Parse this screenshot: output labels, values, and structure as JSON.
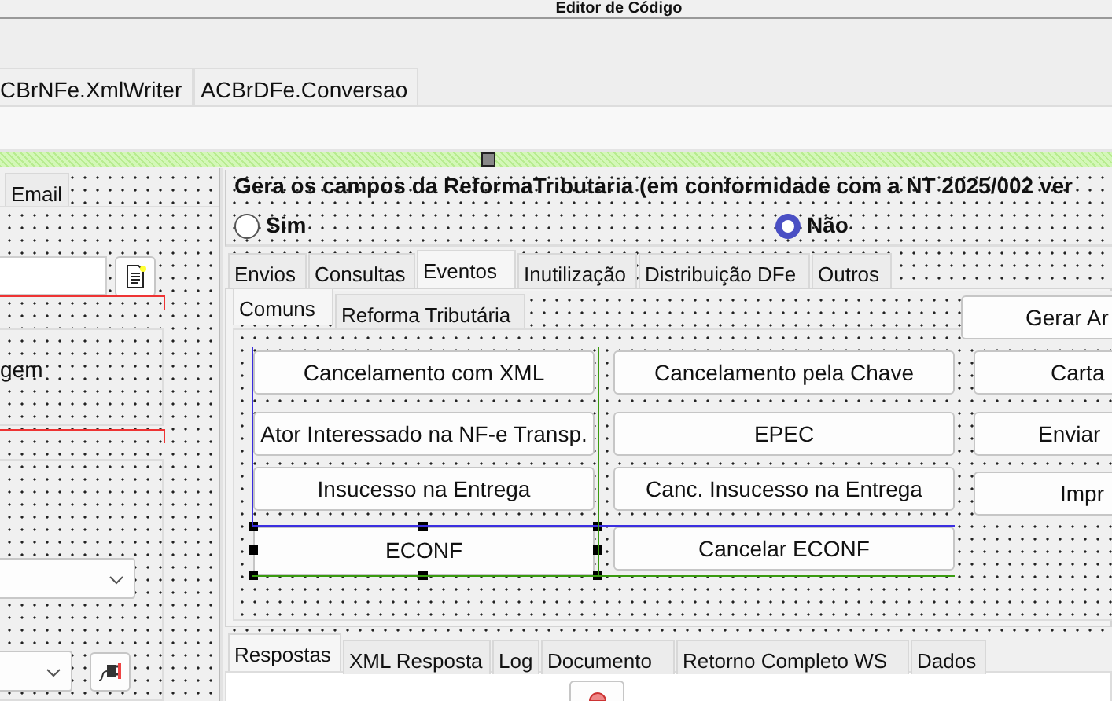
{
  "window": {
    "title": "Editor de Código"
  },
  "unit_tabs": [
    {
      "label": "CBrNFe.XmlWriter",
      "selected": false
    },
    {
      "label": "ACBrDFe.Conversao",
      "selected": false
    }
  ],
  "left_panel": {
    "tabs": [
      "Email"
    ],
    "panel_text": "gem"
  },
  "reforma": {
    "heading": "Gera os campos da ReformaTributaria (em conformidade com a NT 2025/002 ver",
    "options": [
      {
        "label": "Sim",
        "selected": false
      },
      {
        "label": "Não",
        "selected": true
      }
    ]
  },
  "main_tabs": [
    {
      "label": "Envios",
      "selected": false
    },
    {
      "label": "Consultas",
      "selected": false
    },
    {
      "label": "Eventos",
      "selected": true
    },
    {
      "label": "Inutilização",
      "selected": false
    },
    {
      "label": "Distribuição DFe",
      "selected": false
    },
    {
      "label": "Outros",
      "selected": false
    }
  ],
  "sub_tabs": [
    {
      "label": "Comuns",
      "selected": true
    },
    {
      "label": "Reforma Tributária",
      "selected": false
    }
  ],
  "buttons": [
    {
      "label": "Cancelamento com XML",
      "selected": false
    },
    {
      "label": "Cancelamento pela Chave",
      "selected": false
    },
    {
      "label": "Ator Interessado na NF-e Transp.",
      "selected": false
    },
    {
      "label": "EPEC",
      "selected": false
    },
    {
      "label": "Insucesso na Entrega",
      "selected": false
    },
    {
      "label": "Canc. Insucesso na Entrega",
      "selected": false
    },
    {
      "label": "ECONF",
      "selected": true
    },
    {
      "label": "Cancelar ECONF",
      "selected": false
    }
  ],
  "side_buttons": [
    "Gerar Ar",
    "Carta",
    "Enviar",
    "Impr"
  ],
  "result_tabs": [
    {
      "label": "Respostas",
      "selected": true
    },
    {
      "label": "XML Resposta",
      "selected": false
    },
    {
      "label": "Log",
      "selected": false
    },
    {
      "label": "Documento",
      "selected": false
    },
    {
      "label": "Retorno Completo WS",
      "selected": false
    },
    {
      "label": "Dados",
      "selected": false
    }
  ]
}
